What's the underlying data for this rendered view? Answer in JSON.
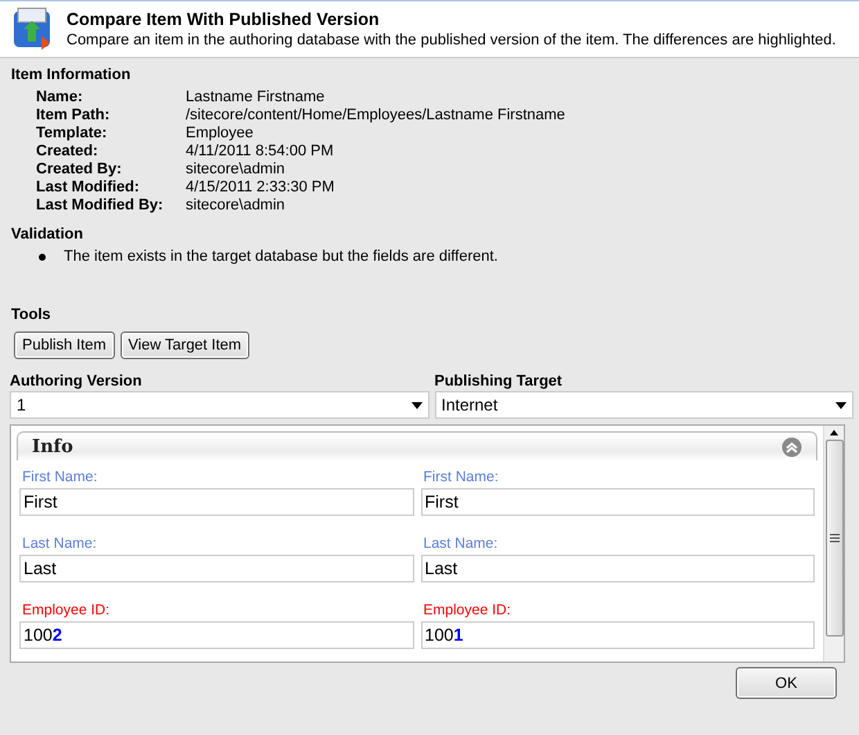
{
  "header": {
    "title": "Compare Item With Published Version",
    "description": "Compare an item in the authoring database with the published version of the item. The differences are highlighted."
  },
  "item_information": {
    "heading": "Item Information",
    "rows": [
      {
        "label": "Name:",
        "value": "Lastname Firstname"
      },
      {
        "label": "Item Path:",
        "value": "/sitecore/content/Home/Employees/Lastname Firstname"
      },
      {
        "label": "Template:",
        "value": "Employee"
      },
      {
        "label": "Created:",
        "value": "4/11/2011 8:54:00 PM"
      },
      {
        "label": "Created By:",
        "value": "sitecore\\admin"
      },
      {
        "label": "Last Modified:",
        "value": "4/15/2011 2:33:30 PM"
      },
      {
        "label": "Last Modified By:",
        "value": "sitecore\\admin"
      }
    ]
  },
  "validation": {
    "heading": "Validation",
    "messages": [
      "The item exists in the target database but the fields are different."
    ]
  },
  "tools": {
    "heading": "Tools",
    "buttons": [
      "Publish Item",
      "View Target Item"
    ]
  },
  "selectors": [
    {
      "label": "Authoring Version",
      "value": "1"
    },
    {
      "label": "Publishing Target",
      "value": "Internet"
    }
  ],
  "section": {
    "title": "Info",
    "fields": [
      {
        "different": false,
        "authoring": {
          "label": "First Name:",
          "value": "First"
        },
        "target": {
          "label": "First Name:",
          "value": "First"
        }
      },
      {
        "different": false,
        "authoring": {
          "label": "Last Name:",
          "value": "Last"
        },
        "target": {
          "label": "Last Name:",
          "value": "Last"
        }
      },
      {
        "different": true,
        "authoring": {
          "label": "Employee ID:",
          "value": "100**2**"
        },
        "target": {
          "label": "Employee ID:",
          "value": "100**1**"
        }
      }
    ]
  },
  "footer": {
    "button": "OK"
  }
}
